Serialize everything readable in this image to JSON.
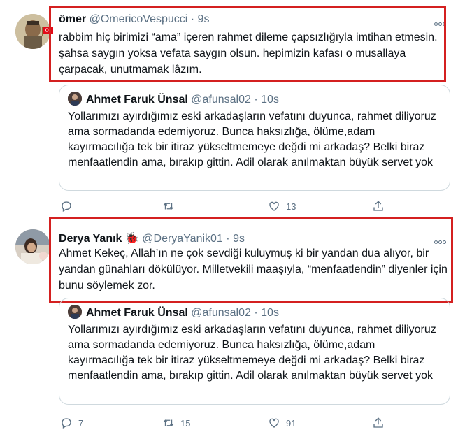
{
  "tweets": [
    {
      "name": "ömer",
      "name_emoji": "",
      "handle": "@OmericoVespucci",
      "dot": "·",
      "time": "9s",
      "text": "rabbim hiç birimizi “ama” içeren rahmet dileme çapsızlığıyla imtihan etmesin. şahsa saygın yoksa vefata saygın olsun. hepimizin kafası o musallaya çarpacak, unutmamak lâzım.",
      "quote": {
        "name": "Ahmet Faruk Ünsal",
        "handle": "@afunsal02",
        "dot": "·",
        "time": "10s",
        "text": "Yollarımızı ayırdığımız eski arkadaşların vefatını duyunca, rahmet diliyoruz ama sormadanda edemiyoruz. Bunca haksızlığa, ölüme,adam kayırmacılığa tek bir itiraz yükseltmemeye değdi mi arkadaş? Belki biraz menfaatlendin ama, bırakıp gittin. Adil olarak anılmaktan büyük servet yok"
      },
      "actions": {
        "reply_count": "",
        "retweet_count": "",
        "like_count": "13"
      }
    },
    {
      "name": "Derya Yanık",
      "name_emoji": "🐞",
      "handle": "@DeryaYanik01",
      "dot": "·",
      "time": "9s",
      "text": "Ahmet Kekeç, Allah’ın ne çok sevdiği kuluymuş ki bir yandan dua alıyor, bir yandan günahları dökülüyor. Milletvekili maaşıyla, “menfaatlendin” diyenler için bunu söylemek zor.",
      "quote": {
        "name": "Ahmet Faruk Ünsal",
        "handle": "@afunsal02",
        "dot": "·",
        "time": "10s",
        "text": "Yollarımızı ayırdığımız eski arkadaşların vefatını duyunca, rahmet diliyoruz ama sormadanda edemiyoruz. Bunca haksızlığa, ölüme,adam kayırmacılığa tek bir itiraz yükseltmemeye değdi mi arkadaş? Belki biraz menfaatlendin ama, bırakıp gittin. Adil olarak anılmaktan büyük servet yok"
      },
      "actions": {
        "reply_count": "7",
        "retweet_count": "15",
        "like_count": "91"
      }
    }
  ],
  "icons": {
    "reply": "reply-icon",
    "retweet": "retweet-icon",
    "like": "heart-icon",
    "share": "share-icon",
    "more": "more-options-icon"
  },
  "colors": {
    "highlight": "#d42020",
    "secondary_text": "#5b7083",
    "border": "#cfd9de"
  }
}
